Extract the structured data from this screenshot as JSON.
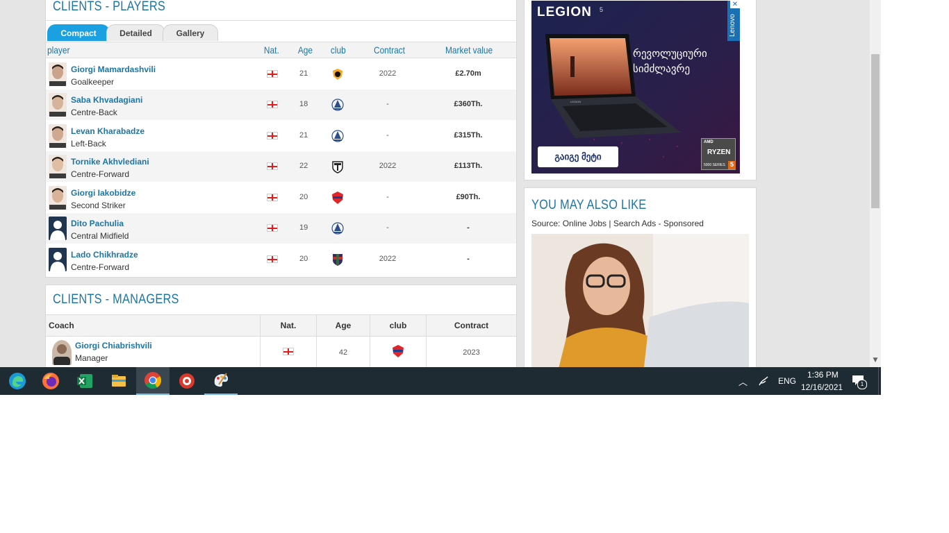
{
  "players_section": {
    "title": "CLIENTS - PLAYERS",
    "tabs": [
      {
        "label": "Compact",
        "active": true
      },
      {
        "label": "Detailed",
        "active": false
      },
      {
        "label": "Gallery",
        "active": false
      }
    ],
    "columns": {
      "player": "player",
      "nat": "Nat.",
      "age": "Age",
      "club": "club",
      "contract": "Contract",
      "market_value": "Market value"
    },
    "rows": [
      {
        "name": "Giorgi Mamardashvili",
        "position": "Goalkeeper",
        "nationality": "georgia-flag-icon",
        "age": "21",
        "club_icon": "valencia-crest-icon",
        "contract": "2022",
        "market_value": "£2.70m"
      },
      {
        "name": "Saba Khvadagiani",
        "position": "Centre-Back",
        "nationality": "georgia-flag-icon",
        "age": "18",
        "club_icon": "dinamo-tbilisi-crest-icon",
        "contract": "-",
        "market_value": "£360Th."
      },
      {
        "name": "Levan Kharabadze",
        "position": "Left-Back",
        "nationality": "georgia-flag-icon",
        "age": "21",
        "club_icon": "dinamo-tbilisi-crest-icon",
        "contract": "-",
        "market_value": "£315Th."
      },
      {
        "name": "Tornike Akhvlediani",
        "position": "Centre-Forward",
        "nationality": "georgia-flag-icon",
        "age": "22",
        "club_icon": "shield-crest-icon",
        "contract": "2022",
        "market_value": "£113Th."
      },
      {
        "name": "Giorgi Iakobidze",
        "position": "Second Striker",
        "nationality": "georgia-flag-icon",
        "age": "20",
        "club_icon": "red-crest-icon",
        "contract": "-",
        "market_value": "£90Th."
      },
      {
        "name": "Dito Pachulia",
        "position": "Central Midfield",
        "nationality": "georgia-flag-icon",
        "age": "19",
        "club_icon": "dinamo-tbilisi-crest-icon",
        "contract": "-",
        "market_value": "-"
      },
      {
        "name": "Lado Chikhradze",
        "position": "Centre-Forward",
        "nationality": "georgia-flag-icon",
        "age": "20",
        "club_icon": "striped-crest-icon",
        "contract": "2022",
        "market_value": "-"
      }
    ]
  },
  "managers_section": {
    "title": "CLIENTS - MANAGERS",
    "columns": {
      "coach": "Coach",
      "nat": "Nat.",
      "age": "Age",
      "club": "club",
      "contract": "Contract"
    },
    "rows": [
      {
        "name": "Giorgi Chiabrishvili",
        "role": "Manager",
        "nationality": "georgia-flag-icon",
        "age": "42",
        "club_icon": "red-crest-icon",
        "contract": "2023"
      }
    ]
  },
  "advert": {
    "brand": "LEGION",
    "brand_sup": "5",
    "vendor": "Lenovo",
    "headline_line1": "რევოლუციური",
    "headline_line2": "სიმძლავრე",
    "cta": "გაიგე მეტი",
    "laptop_label": "LEGION",
    "badge_top": "AMD",
    "badge_main": "RYZEN",
    "badge_series": "5000 SERIES",
    "badge_num": "5",
    "close_glyph": "✕"
  },
  "you_may_also_like": {
    "title": "YOU MAY ALSO LIKE",
    "source": "Source: Online Jobs | Search Ads - Sponsored"
  },
  "taskbar": {
    "apps": [
      {
        "name": "edge-icon",
        "running": false,
        "active": false
      },
      {
        "name": "firefox-icon",
        "running": false,
        "active": false
      },
      {
        "name": "excel-icon",
        "running": false,
        "active": false
      },
      {
        "name": "file-explorer-icon",
        "running": false,
        "active": false
      },
      {
        "name": "chrome-icon",
        "running": true,
        "active": true
      },
      {
        "name": "app-red-icon",
        "running": false,
        "active": false
      },
      {
        "name": "paint-icon",
        "running": true,
        "active": false
      }
    ],
    "language": "ENG",
    "time": "1:36 PM",
    "date": "12/16/2021",
    "notification_count": "1"
  },
  "colors": {
    "link_blue": "#1d75a3",
    "tab_active": "#1ba1e2",
    "taskbar_bg": "#1e2b33"
  }
}
